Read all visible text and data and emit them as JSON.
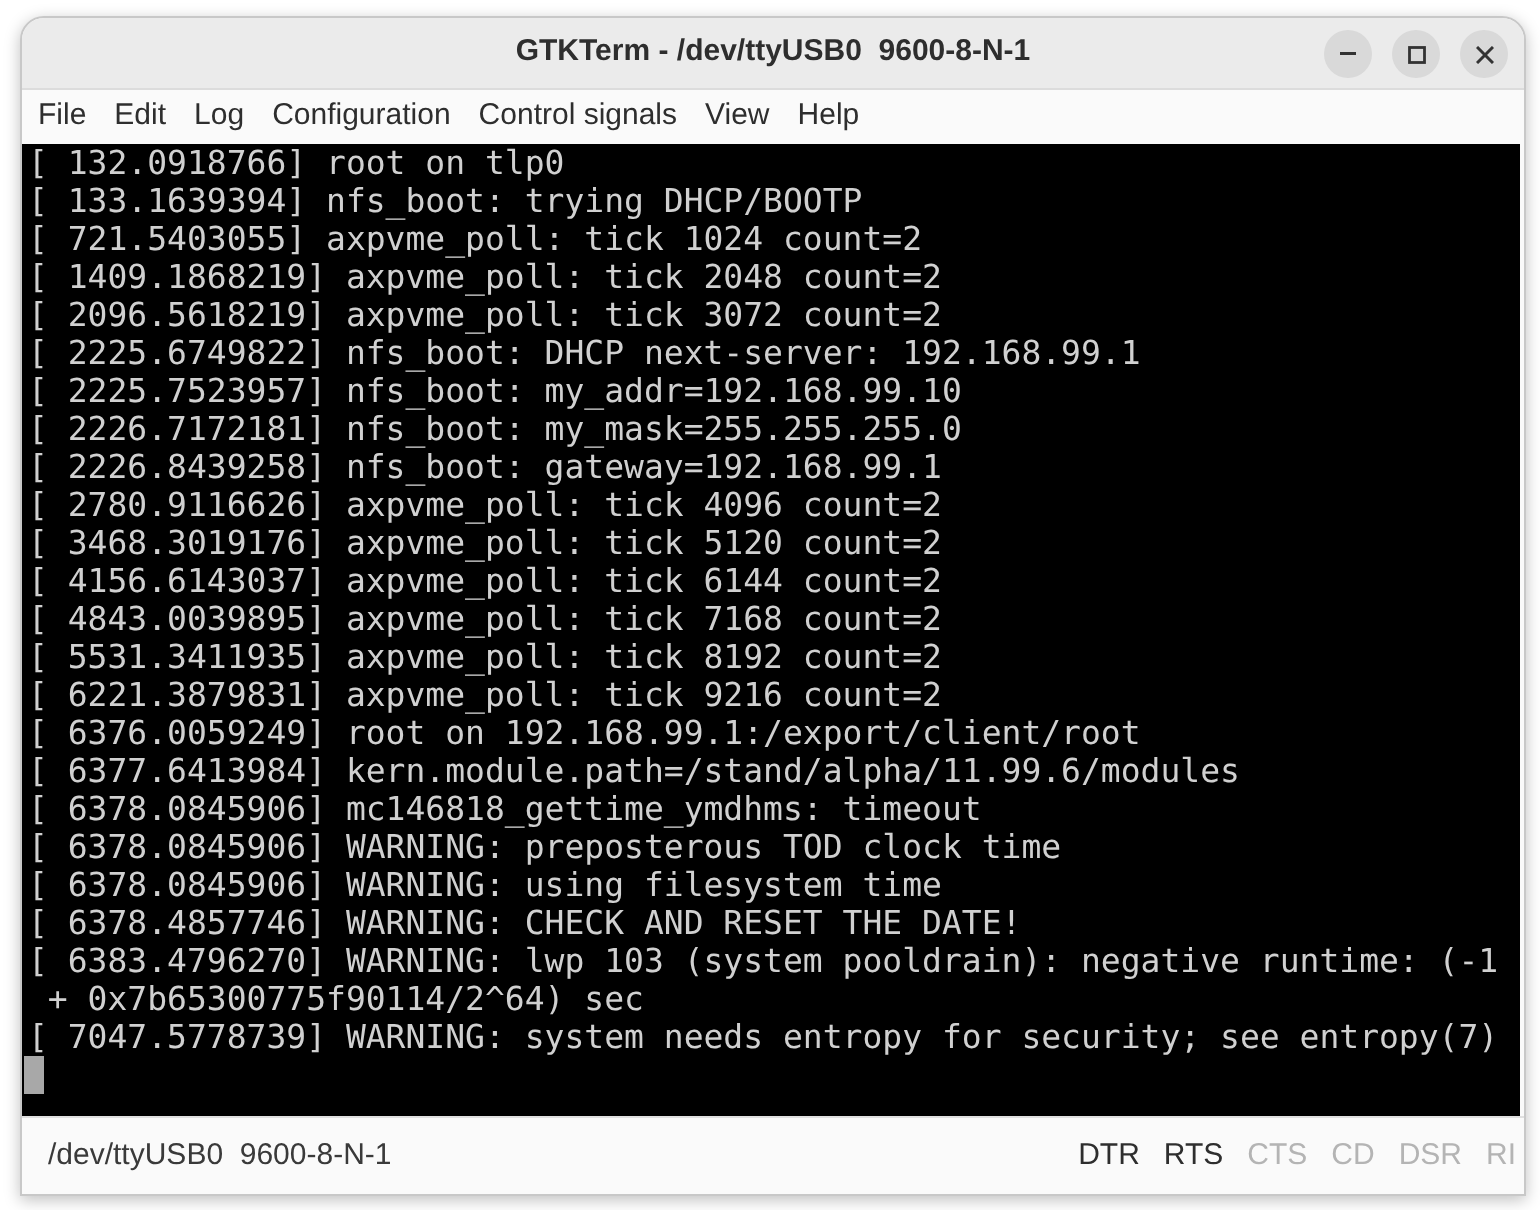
{
  "window": {
    "title": "GTKTerm - /dev/ttyUSB0  9600-8-N-1"
  },
  "menu": [
    "File",
    "Edit",
    "Log",
    "Configuration",
    "Control signals",
    "View",
    "Help"
  ],
  "terminal": {
    "lines": [
      "[ 132.0918766] root on tlp0",
      "[ 133.1639394] nfs_boot: trying DHCP/BOOTP",
      "[ 721.5403055] axpvme_poll: tick 1024 count=2",
      "[ 1409.1868219] axpvme_poll: tick 2048 count=2",
      "[ 2096.5618219] axpvme_poll: tick 3072 count=2",
      "[ 2225.6749822] nfs_boot: DHCP next-server: 192.168.99.1",
      "[ 2225.7523957] nfs_boot: my_addr=192.168.99.10",
      "[ 2226.7172181] nfs_boot: my_mask=255.255.255.0",
      "[ 2226.8439258] nfs_boot: gateway=192.168.99.1",
      "[ 2780.9116626] axpvme_poll: tick 4096 count=2",
      "[ 3468.3019176] axpvme_poll: tick 5120 count=2",
      "[ 4156.6143037] axpvme_poll: tick 6144 count=2",
      "[ 4843.0039895] axpvme_poll: tick 7168 count=2",
      "[ 5531.3411935] axpvme_poll: tick 8192 count=2",
      "[ 6221.3879831] axpvme_poll: tick 9216 count=2",
      "[ 6376.0059249] root on 192.168.99.1:/export/client/root",
      "[ 6377.6413984] kern.module.path=/stand/alpha/11.99.6/modules",
      "[ 6378.0845906] mc146818_gettime_ymdhms: timeout",
      "[ 6378.0845906] WARNING: preposterous TOD clock time",
      "[ 6378.0845906] WARNING: using filesystem time",
      "[ 6378.4857746] WARNING: CHECK AND RESET THE DATE!",
      "[ 6383.4796270] WARNING: lwp 103 (system pooldrain): negative runtime: (-1",
      " + 0x7b65300775f90114/2^64) sec",
      "[ 7047.5778739] WARNING: system needs entropy for security; see entropy(7)"
    ]
  },
  "status_bar": {
    "port": "/dev/ttyUSB0  9600-8-N-1",
    "signals": [
      {
        "label": "DTR",
        "on": true
      },
      {
        "label": "RTS",
        "on": true
      },
      {
        "label": "CTS",
        "on": false
      },
      {
        "label": "CD",
        "on": false
      },
      {
        "label": "DSR",
        "on": false
      },
      {
        "label": "RI",
        "on": false
      }
    ]
  }
}
